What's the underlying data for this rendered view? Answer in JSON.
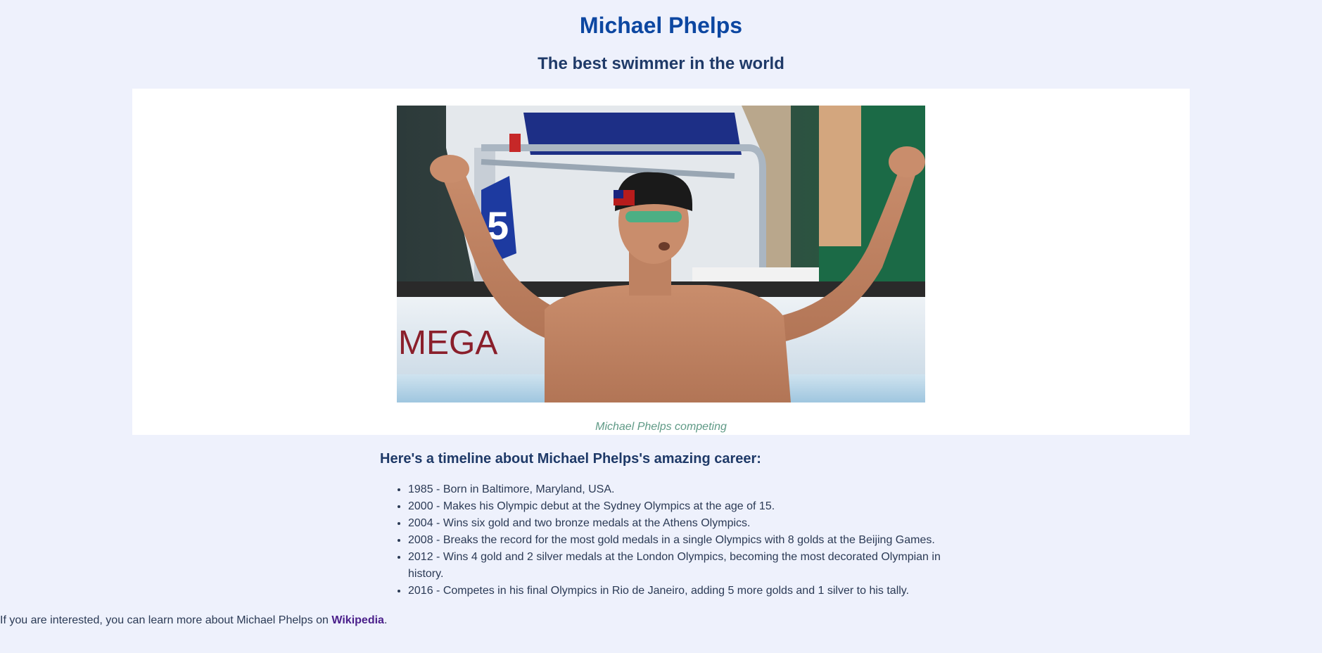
{
  "page": {
    "title": "Michael Phelps",
    "subtitle": "The best swimmer in the world"
  },
  "figure": {
    "image_alt": "Michael Phelps competing",
    "caption": "Michael Phelps competing",
    "signage_text": "MEGA",
    "lane_number": "5"
  },
  "timeline": {
    "heading": "Here's a timeline about Michael Phelps's amazing career:",
    "items": [
      "1985 - Born in Baltimore, Maryland, USA.",
      "2000 - Makes his Olympic debut at the Sydney Olympics at the age of 15.",
      "2004 - Wins six gold and two bronze medals at the Athens Olympics.",
      "2008 - Breaks the record for the most gold medals in a single Olympics with 8 golds at the Beijing Games.",
      "2012 - Wins 4 gold and 2 silver medals at the London Olympics, becoming the most decorated Olympian in history.",
      "2016 - Competes in his final Olympics in Rio de Janeiro, adding 5 more golds and 1 silver to his tally."
    ]
  },
  "footer": {
    "text_before": "If you are interested, you can learn more about Michael Phelps on ",
    "link_label": "Wikipedia",
    "text_after": "."
  },
  "colors": {
    "background": "#eef1fc",
    "title": "#0d47a1",
    "subtitle": "#1f3a68",
    "caption": "#5f9a86",
    "link": "#4a1f8a"
  }
}
